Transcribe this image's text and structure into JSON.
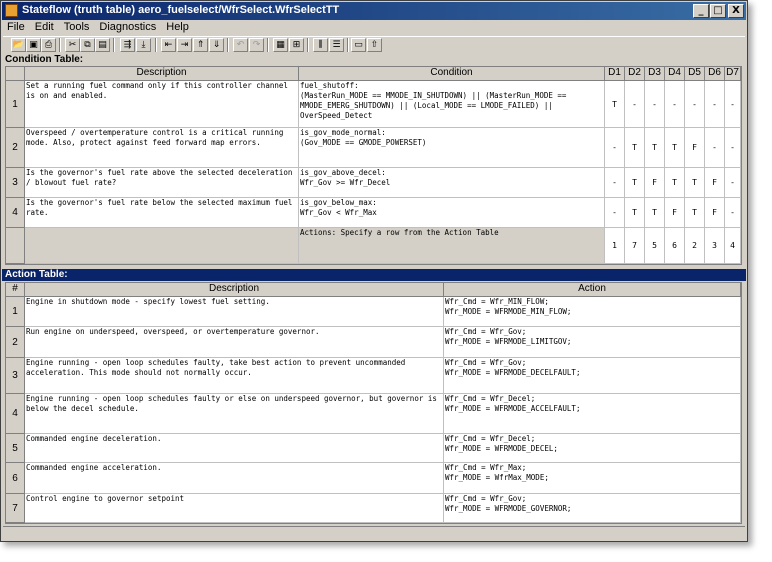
{
  "window": {
    "title": "Stateflow (truth table) aero_fuelselect/WfrSelect.WfrSelectTT",
    "controls": {
      "minimize": "_",
      "maximize": "□",
      "close": "X"
    }
  },
  "menu": [
    "File",
    "Edit",
    "Tools",
    "Diagnostics",
    "Help"
  ],
  "toolbar": {
    "icons": [
      "open-icon",
      "save-icon",
      "print-icon",
      "cut-icon",
      "copy-icon",
      "paste-icon",
      "edit-data-icon",
      "append-row-icon",
      "move-left-icon",
      "move-right-icon",
      "move-up-icon",
      "move-down-icon",
      "undo-icon",
      "redo-icon",
      "check-table-icon",
      "run-diagnostics-icon",
      "insert-column-icon",
      "insert-row-icon",
      "explorer-icon",
      "goto-parent-icon"
    ]
  },
  "condition_table": {
    "label": "Condition Table:",
    "headers": {
      "description": "Description",
      "condition": "Condition",
      "decisions": [
        "D1",
        "D2",
        "D3",
        "D4",
        "D5",
        "D6",
        "D7"
      ]
    },
    "rows": [
      {
        "num": "1",
        "description": "Set a running fuel command only if this controller channel is on and enabled.",
        "condition": "fuel_shutoff:\n(MasterRun_MODE == MMODE_IN_SHUTDOWN) || (MasterRun_MODE == MMODE_EMERG_SHUTDOWN) || (Local_MODE == LMODE_FAILED) || OverSpeed_Detect",
        "decisions": [
          "T",
          "-",
          "-",
          "-",
          "-",
          "-",
          "-"
        ]
      },
      {
        "num": "2",
        "description": "Overspeed / overtemperature control is a critical running mode. Also, protect against feed forward map errors.",
        "condition": "is_gov_mode_normal:\n(Gov_MODE == GMODE_POWERSET)",
        "decisions": [
          "-",
          "T",
          "T",
          "T",
          "F",
          "-",
          "-"
        ]
      },
      {
        "num": "3",
        "description": "Is the governor's fuel rate above the selected deceleration / blowout fuel rate?",
        "condition": "is_gov_above_decel:\nWfr_Gov >= Wfr_Decel",
        "decisions": [
          "-",
          "T",
          "F",
          "T",
          "T",
          "F",
          "-"
        ]
      },
      {
        "num": "4",
        "description": "Is the governor's fuel rate below the selected maximum fuel rate.",
        "condition": "is_gov_below_max:\nWfr_Gov < Wfr_Max",
        "decisions": [
          "-",
          "T",
          "T",
          "F",
          "T",
          "F",
          "-"
        ]
      }
    ],
    "actions_row": {
      "text": "Actions: Specify a row from the Action Table",
      "values": [
        "1",
        "7",
        "5",
        "6",
        "2",
        "3",
        "4"
      ]
    }
  },
  "action_table": {
    "label": "Action Table:",
    "headers": {
      "num": "#",
      "description": "Description",
      "action": "Action"
    },
    "rows": [
      {
        "num": "1",
        "description": "Engine in shutdown mode - specify lowest fuel setting.",
        "action": "Wfr_Cmd = Wfr_MIN_FLOW;\nWfr_MODE = WFRMODE_MIN_FLOW;"
      },
      {
        "num": "2",
        "description": "Run engine on underspeed, overspeed, or overtemperature governor.",
        "action": "Wfr_Cmd = Wfr_Gov;\nWfr_MODE = WFRMODE_LIMITGOV;"
      },
      {
        "num": "3",
        "description": "Engine running - open loop schedules faulty, take best action to prevent uncommanded acceleration. This mode should not normally occur.",
        "action": "Wfr_Cmd = Wfr_Gov;\nWfr_MODE = WFRMODE_DECELFAULT;"
      },
      {
        "num": "4",
        "description": "Engine running - open loop schedules faulty or else on underspeed governor, but governor is below the decel schedule.",
        "action": "Wfr_Cmd = Wfr_Decel;\nWfr_MODE = WFRMODE_ACCELFAULT;"
      },
      {
        "num": "5",
        "description": "Commanded engine deceleration.",
        "action": "Wfr_Cmd = Wfr_Decel;\nWfr_MODE = WFRMODE_DECEL;"
      },
      {
        "num": "6",
        "description": "Commanded engine acceleration.",
        "action": "Wfr_Cmd = Wfr_Max;\nWfr_MODE = WfrMax_MODE;"
      },
      {
        "num": "7",
        "description": "Control engine to governor setpoint",
        "action": "Wfr_Cmd = Wfr_Gov;\nWfr_MODE = WFRMODE_GOVERNOR;"
      }
    ]
  }
}
